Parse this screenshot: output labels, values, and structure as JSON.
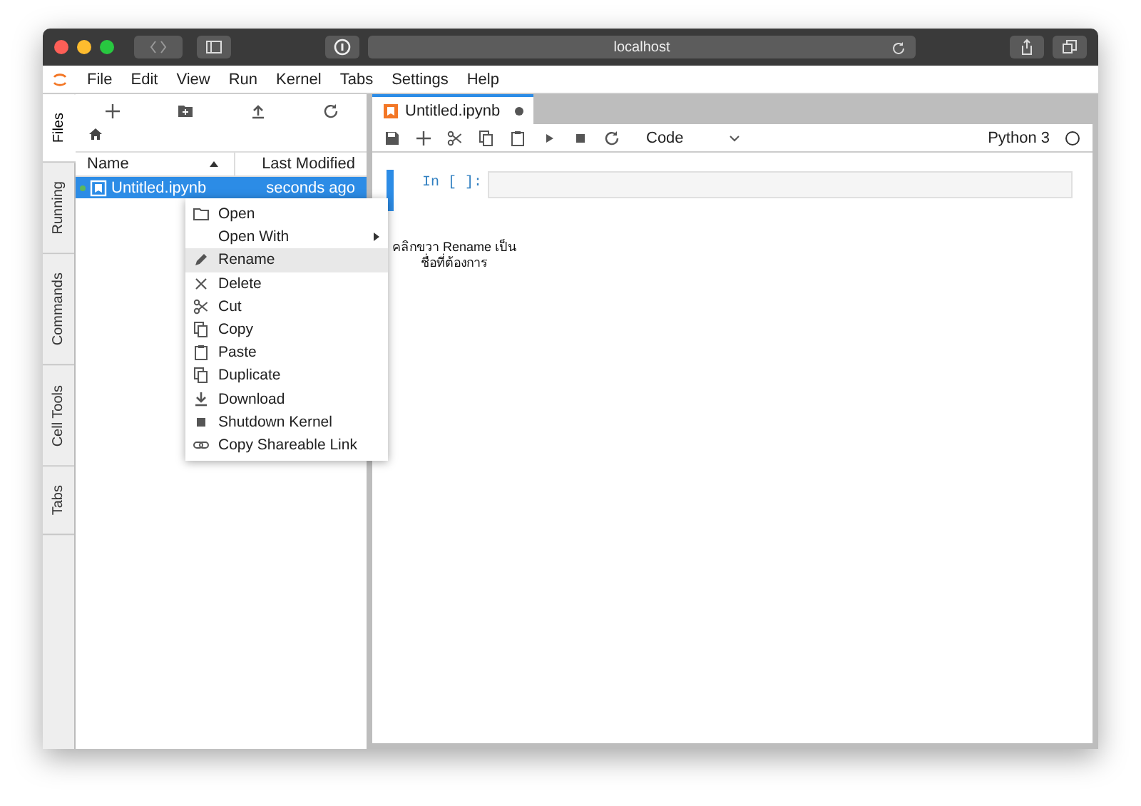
{
  "browser": {
    "address": "localhost"
  },
  "menu_bar": [
    "File",
    "Edit",
    "View",
    "Run",
    "Kernel",
    "Tabs",
    "Settings",
    "Help"
  ],
  "side_tabs": [
    {
      "label": "Files",
      "selected": true
    },
    {
      "label": "Running",
      "selected": false
    },
    {
      "label": "Commands",
      "selected": false
    },
    {
      "label": "Cell Tools",
      "selected": false
    },
    {
      "label": "Tabs",
      "selected": false
    }
  ],
  "file_browser": {
    "columns": [
      "Name",
      "Last Modified"
    ],
    "files": [
      {
        "name": "Untitled.ipynb",
        "modified": "seconds ago",
        "selected": true,
        "running": true
      }
    ]
  },
  "notebook_tabs": [
    {
      "label": "Untitled.ipynb",
      "selected": true,
      "modified": true
    }
  ],
  "toolbar": {
    "cell_type": "Code",
    "kernel": "Python 3"
  },
  "cells": [
    {
      "prompt": "In [ ]:",
      "active": true
    }
  ],
  "context_menu": [
    {
      "label": "Open",
      "selected": false,
      "submenu": false
    },
    {
      "label": "Open With",
      "selected": false,
      "submenu": true
    },
    {
      "label": "Rename",
      "selected": true,
      "submenu": false
    },
    {
      "label": "Delete",
      "selected": false,
      "submenu": false
    },
    {
      "label": "Cut",
      "selected": false,
      "submenu": false
    },
    {
      "label": "Copy",
      "selected": false,
      "submenu": false
    },
    {
      "label": "Paste",
      "selected": false,
      "submenu": false
    },
    {
      "label": "Duplicate",
      "selected": false,
      "submenu": false
    },
    {
      "label": "Download",
      "selected": false,
      "submenu": false
    },
    {
      "label": "Shutdown Kernel",
      "selected": false,
      "submenu": false
    },
    {
      "label": "Copy Shareable Link",
      "selected": false,
      "submenu": false
    }
  ],
  "annotation": [
    "คลิกขวา Rename เป็น",
    "ชื่อที่ต้องการ"
  ]
}
